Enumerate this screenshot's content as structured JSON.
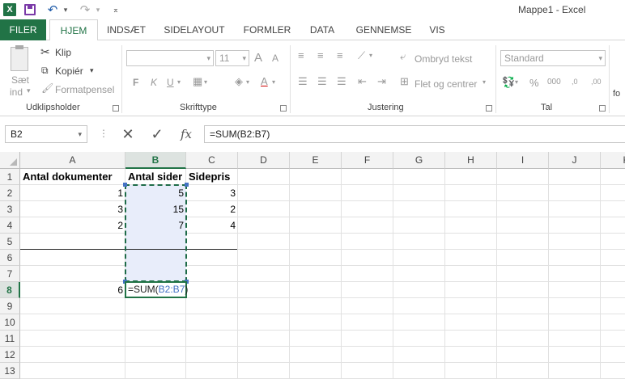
{
  "window": {
    "title": "Mappe1 - Excel"
  },
  "quick_access": [
    {
      "icon": "excel-app-icon",
      "glyph": "X"
    },
    {
      "icon": "save-icon"
    },
    {
      "icon": "undo-icon",
      "glyph": "↶"
    },
    {
      "icon": "undo-dropdown-icon",
      "glyph": "▾"
    },
    {
      "icon": "redo-icon",
      "glyph": "↷"
    },
    {
      "icon": "redo-dropdown-icon",
      "glyph": "▾"
    },
    {
      "icon": "customize-qat-icon",
      "glyph": "⌅"
    }
  ],
  "ribbon_tabs": [
    "FILER",
    "HJEM",
    "INDSÆT",
    "SIDELAYOUT",
    "FORMLER",
    "DATA",
    "GENNEMSE",
    "VIS"
  ],
  "ribbon": {
    "clipboard": {
      "paste_line1": "Sæt",
      "paste_line2": "ind",
      "paste_arrow": "▾",
      "cut": "Klip",
      "copy": "Kopiér",
      "copy_arrow": "▾",
      "format_painter": "Formatpensel",
      "label": "Udklipsholder"
    },
    "font": {
      "font_name": "",
      "font_size": "11",
      "grow": "A",
      "shrink": "A",
      "bold": "F",
      "italic": "K",
      "underline": "U",
      "label": "Skrifttype"
    },
    "alignment": {
      "wrap_text": "Ombryd tekst",
      "merge_center": "Flet og centrer",
      "label": "Justering"
    },
    "number": {
      "format": "Standard",
      "percent": "%",
      "thousands": "000",
      "dec_more": ",0",
      "dec_less": ",00",
      "label": "Tal"
    },
    "overflow_label": "fo"
  },
  "formula_bar": {
    "name_box": "B2",
    "dots": "⋮",
    "cancel": "✕",
    "enter": "✓",
    "function": "fx",
    "formula": "=SUM(B2:B7)"
  },
  "sheet": {
    "columns": [
      "A",
      "B",
      "C",
      "D",
      "E",
      "F",
      "G",
      "H",
      "I",
      "J",
      "K"
    ],
    "rows": [
      "1",
      "2",
      "3",
      "4",
      "5",
      "6",
      "7",
      "8",
      "9",
      "10",
      "11",
      "12",
      "13"
    ],
    "cells": {
      "A1": "Antal dokumenter",
      "B1": "Antal sider",
      "C1": "Sidepris",
      "A2": "1",
      "B2": "5",
      "C2": "3",
      "A3": "3",
      "B3": "15",
      "C3": "2",
      "A4": "2",
      "B4": "7",
      "C4": "4",
      "A8": "6"
    },
    "edit_cell": {
      "address": "B8",
      "prefix": "=SUM(",
      "ref": "B2:B7",
      "suffix": ")"
    },
    "active_column": "B",
    "active_row": "8"
  },
  "colors": {
    "accent": "#217346",
    "selection": "#e8edfa",
    "reference": "#4472c4"
  }
}
